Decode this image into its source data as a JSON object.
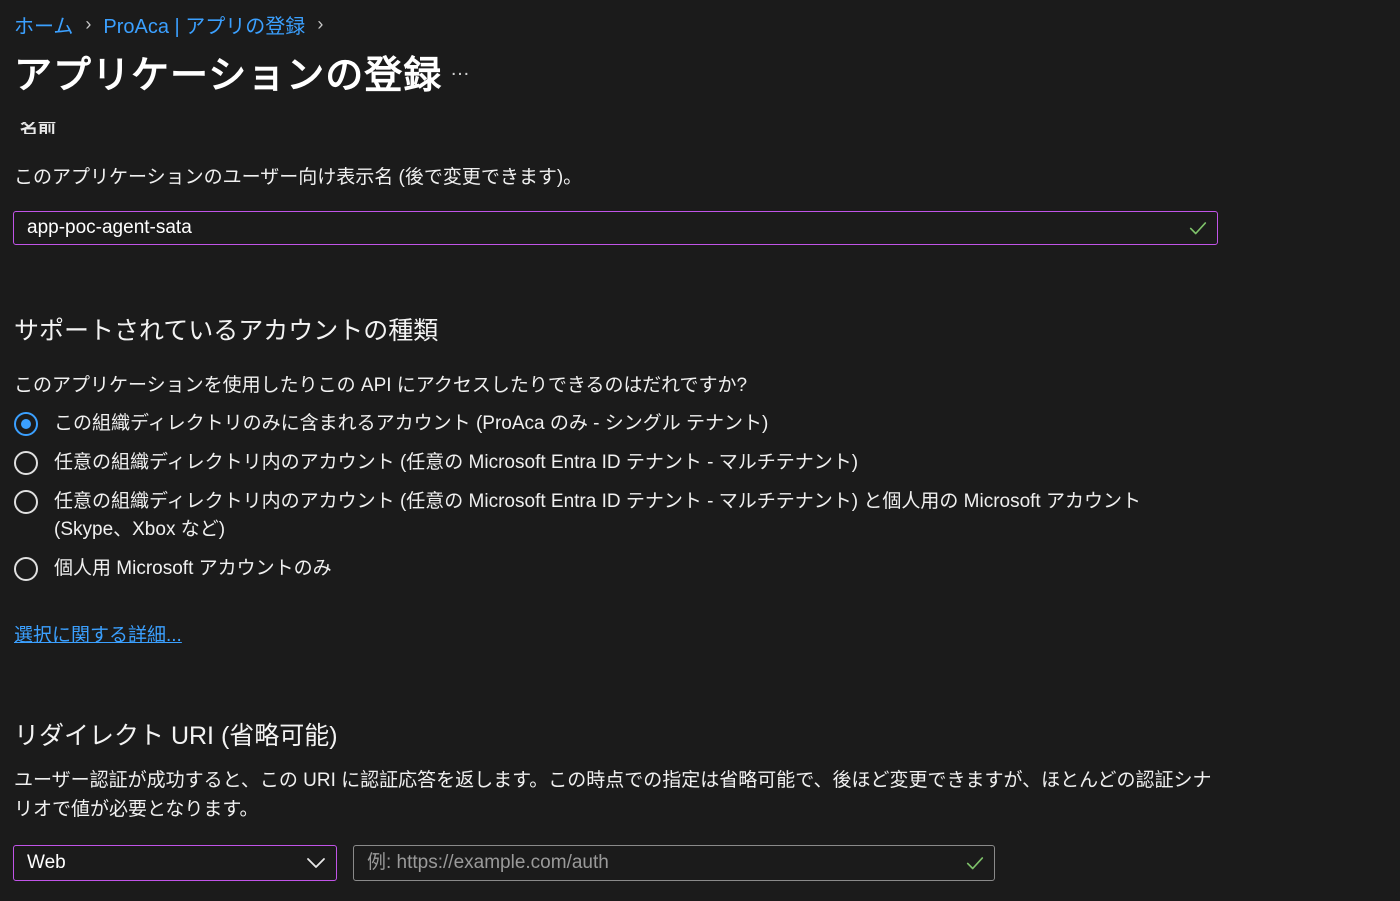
{
  "breadcrumb": {
    "home": "ホーム",
    "parent": "ProAca | アプリの登録"
  },
  "page": {
    "title": "アプリケーションの登録",
    "more": "…"
  },
  "name_section": {
    "clipped_label": "名前",
    "description": "このアプリケーションのユーザー向け表示名 (後で変更できます)。",
    "value": "app-poc-agent-sata"
  },
  "account_section": {
    "heading": "サポートされているアカウントの種類",
    "question": "このアプリケーションを使用したりこの API にアクセスしたりできるのはだれですか?",
    "options": [
      {
        "label": "この組織ディレクトリのみに含まれるアカウント (ProAca のみ - シングル テナント)",
        "checked": true
      },
      {
        "label": "任意の組織ディレクトリ内のアカウント (任意の Microsoft Entra ID テナント - マルチテナント)",
        "checked": false
      },
      {
        "label": "任意の組織ディレクトリ内のアカウント (任意の Microsoft Entra ID テナント - マルチテナント) と個人用の Microsoft アカウント (Skype、Xbox など)",
        "checked": false
      },
      {
        "label": "個人用 Microsoft アカウントのみ",
        "checked": false
      }
    ],
    "help_link": "選択に関する詳細..."
  },
  "redirect_section": {
    "heading": "リダイレクト URI (省略可能)",
    "description": "ユーザー認証が成功すると、この URI に認証応答を返します。この時点での指定は省略可能で、後ほど変更できますが、ほとんどの認証シナリオで値が必要となります。",
    "platform_value": "Web",
    "uri_placeholder": "例: https://example.com/auth"
  },
  "colors": {
    "background": "#1b1b1b",
    "link": "#3ba0ff",
    "focus_border": "#c154e8",
    "valid_check": "#7ec26a"
  },
  "icons": [
    "chevron-right-icon",
    "checkmark-icon",
    "chevron-down-icon",
    "more-icon"
  ]
}
